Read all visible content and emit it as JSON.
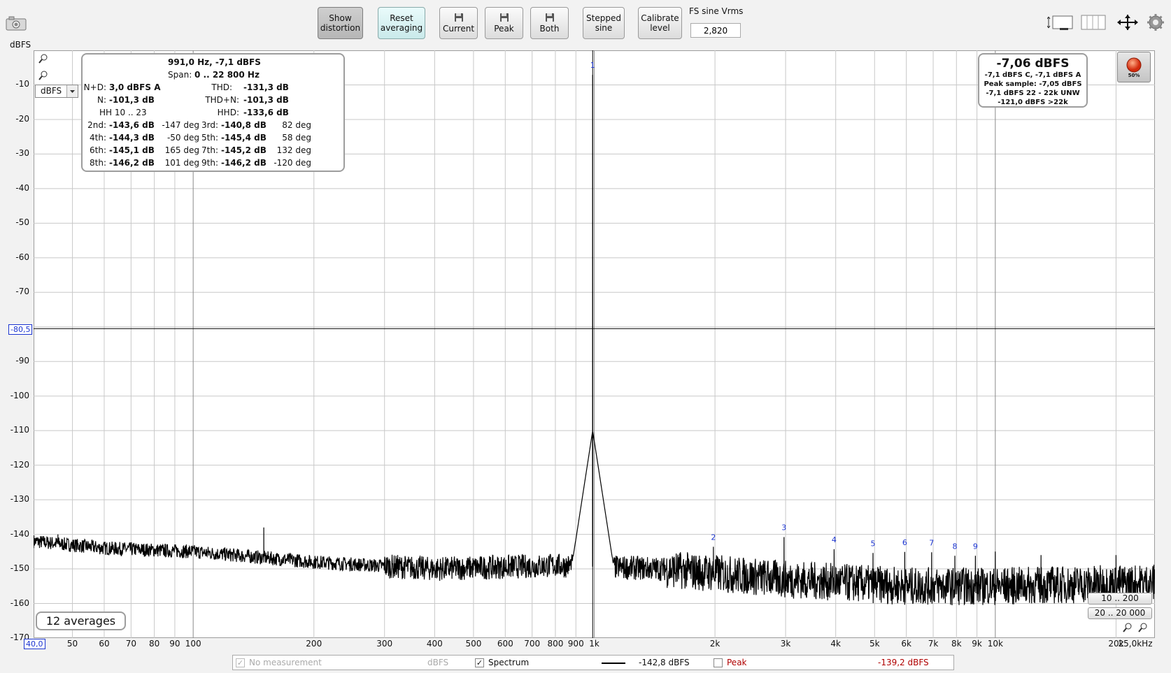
{
  "toolbar": {
    "show_distortion": [
      "Show",
      "distortion"
    ],
    "reset_averaging": [
      "Reset",
      "averaging"
    ],
    "current": "Current",
    "peak": "Peak",
    "both": "Both",
    "stepped_sine": [
      "Stepped",
      "sine"
    ],
    "calibrate_level": [
      "Calibrate",
      "level"
    ],
    "fs_label": "FS sine Vrms",
    "fs_value": "2,820"
  },
  "plot": {
    "y_unit": "dBFS",
    "y_ticks": [
      "-10",
      "-20",
      "-30",
      "-40",
      "-50",
      "-60",
      "-70",
      "-90",
      "-100",
      "-110",
      "-120",
      "-130",
      "-140",
      "-150",
      "-160",
      "-170"
    ],
    "x_ticks": [
      "50",
      "60",
      "70",
      "80",
      "90",
      "100",
      "200",
      "300",
      "400",
      "500",
      "600",
      "700",
      "800",
      "900",
      "1k",
      "2k",
      "3k",
      "4k",
      "5k",
      "6k",
      "7k",
      "8k",
      "9k",
      "10k",
      "20k",
      "25,0kHz"
    ],
    "x_min_badge": "40,0",
    "cursor_y_badge": "-80,5",
    "units_select": "dBFS",
    "averages": "12 averages",
    "range_btn_1": "10 .. 200",
    "range_btn_2": "20 .. 20 000",
    "harmonic_labels": [
      "1",
      "2",
      "3",
      "4",
      "5",
      "6",
      "7",
      "8",
      "9"
    ]
  },
  "distortion": {
    "header": "991,0 Hz, -7,1 dBFS",
    "span_label": "Span:",
    "span_value": "0 .. 22 800 Hz",
    "nd_label": "N+D:",
    "nd_value": "3,0 dBFS A",
    "thd_label": "THD:",
    "thd_value": "-131,3 dB",
    "n_label": "N:",
    "n_value": "-101,3 dB",
    "thdn_label": "THD+N:",
    "thdn_value": "-101,3 dB",
    "hh_label": "HH 10 .. 23",
    "hhd_label": "HHD:",
    "hhd_value": "-133,6 dB",
    "harmonics": [
      {
        "label": "2nd:",
        "db": "-143,6 dB",
        "deg": "-147 deg"
      },
      {
        "label": "3rd:",
        "db": "-140,8 dB",
        "deg": "82 deg"
      },
      {
        "label": "4th:",
        "db": "-144,3 dB",
        "deg": "-50 deg"
      },
      {
        "label": "5th:",
        "db": "-145,4 dB",
        "deg": "58 deg"
      },
      {
        "label": "6th:",
        "db": "-145,1 dB",
        "deg": "165 deg"
      },
      {
        "label": "7th:",
        "db": "-145,2 dB",
        "deg": "132 deg"
      },
      {
        "label": "8th:",
        "db": "-146,2 dB",
        "deg": "101 deg"
      },
      {
        "label": "9th:",
        "db": "-146,2 dB",
        "deg": "-120 deg"
      }
    ]
  },
  "level": {
    "main": "-7,06 dBFS",
    "line1": "-7,1 dBFS C, -7,1 dBFS A",
    "line2": "Peak sample: -7,05 dBFS",
    "line3": "-7,1 dBFS 22 - 22k UNW",
    "line4": "-121,0 dBFS >22k",
    "rec_percent": "50%"
  },
  "legend": {
    "no_measurement": "No measurement",
    "no_measurement_unit": "dBFS",
    "spectrum": "Spectrum",
    "spectrum_value": "-142,8 dBFS",
    "peak": "Peak",
    "peak_value": "-139,2 dBFS"
  },
  "chart_data": {
    "type": "line",
    "x_scale": "log",
    "xlim": [
      40,
      25000
    ],
    "ylim": [
      -170,
      0
    ],
    "ylabel": "dBFS",
    "fundamental": {
      "freq": 991,
      "level": -7.1
    },
    "harmonics": [
      {
        "n": 1,
        "freq": 991,
        "level": -7.1
      },
      {
        "n": 2,
        "freq": 1982,
        "level": -143.6
      },
      {
        "n": 3,
        "freq": 2973,
        "level": -140.8
      },
      {
        "n": 4,
        "freq": 3964,
        "level": -144.3
      },
      {
        "n": 5,
        "freq": 4955,
        "level": -145.4
      },
      {
        "n": 6,
        "freq": 5946,
        "level": -145.1
      },
      {
        "n": 7,
        "freq": 6937,
        "level": -145.2
      },
      {
        "n": 8,
        "freq": 7928,
        "level": -146.2
      },
      {
        "n": 9,
        "freq": 8919,
        "level": -146.2
      }
    ],
    "noise_floor": [
      [
        40,
        -142
      ],
      [
        60,
        -144
      ],
      [
        100,
        -145
      ],
      [
        200,
        -148
      ],
      [
        400,
        -150
      ],
      [
        800,
        -149
      ],
      [
        1500,
        -150
      ],
      [
        3000,
        -153
      ],
      [
        6000,
        -155
      ],
      [
        10000,
        -155
      ],
      [
        25000,
        -154
      ]
    ],
    "spurs": [
      {
        "freq": 150,
        "level": -138
      },
      {
        "freq": 46,
        "level": -140
      },
      {
        "freq": 10000,
        "level": -145
      },
      {
        "freq": 13000,
        "level": -146
      },
      {
        "freq": 20000,
        "level": -146
      }
    ],
    "cursor_level": -80.5,
    "grid": true
  },
  "colors": {
    "trace": "#000000",
    "grid": "#c8c8c8",
    "harmonic_label": "#1b34d0",
    "peak_text": "#b00000",
    "record": "#e03a1a"
  }
}
